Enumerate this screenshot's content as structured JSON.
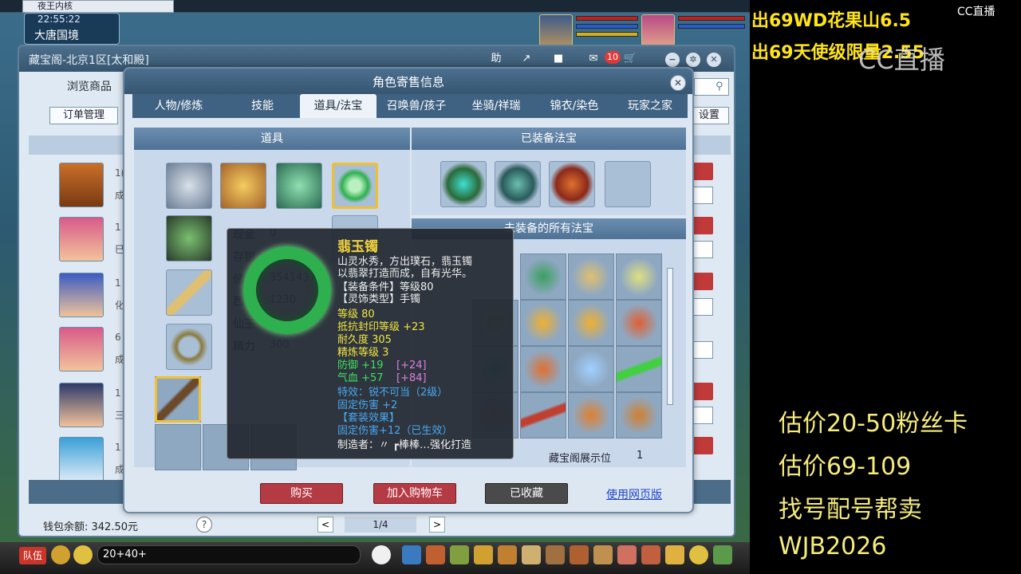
{
  "browser_tab": "夜王内核",
  "clock": "22:55:22",
  "location": "大唐国境",
  "main_window": {
    "title": "藏宝阁-北京1区[太和殿]",
    "help_btn": "助",
    "notification_count": "10",
    "browse_tab": "浏览商品",
    "order_btn": "订单管理",
    "settings_btn": "设置",
    "rows": [
      {
        "level": "1(",
        "sub": "成"
      },
      {
        "level": "1",
        "sub": "巳"
      },
      {
        "level": "1",
        "sub": "化"
      },
      {
        "level": "6",
        "sub": "成"
      },
      {
        "level": "1",
        "sub": "三"
      },
      {
        "level": "1",
        "sub": "成"
      }
    ],
    "wallet": "钱包余额: 342.50元",
    "help_icon": "?",
    "pager_prev": "<",
    "pager_text": "1/4",
    "pager_next": ">"
  },
  "dialog": {
    "title": "角色寄售信息",
    "close": "✕",
    "tabs": [
      "人物/修炼",
      "技能",
      "道具/法宝",
      "召唤兽/孩子",
      "坐骑/祥瑞",
      "锦衣/染色",
      "玩家之家"
    ],
    "left_header": "道具",
    "right_header": "已装备法宝",
    "right_sub_header": "未装备的所有法宝",
    "stats": [
      {
        "label": "现金",
        "value": "0"
      },
      {
        "label": "存银",
        "value": ""
      },
      {
        "label": "储",
        "value": "3541437"
      },
      {
        "label": "西",
        "value": "1230"
      },
      {
        "label": "仙玉",
        "value": ""
      },
      {
        "label": "精力",
        "value": "300"
      }
    ],
    "showcase_label": "藏宝阁展示位",
    "showcase_value": "1",
    "buttons": {
      "buy": "购买",
      "add_cart": "加入购物车",
      "favorited": "已收藏",
      "web": "使用网页版"
    }
  },
  "tooltip": {
    "name": "翡玉镯",
    "lines": [
      {
        "text": "山灵水秀，方出璞石，翡玉镯",
        "color": "white"
      },
      {
        "text": "以翡翠打造而成，自有光华。",
        "color": "white"
      },
      {
        "text": "【装备条件】等级80",
        "color": "white"
      },
      {
        "text": "【灵饰类型】手镯",
        "color": "white"
      },
      {
        "text": "等级 80",
        "color": "yellow"
      },
      {
        "text": "抵抗封印等级 +23",
        "color": "yellow"
      },
      {
        "text": "耐久度 305",
        "color": "yellow"
      },
      {
        "text": "精炼等级 3",
        "color": "yellow"
      },
      {
        "text": "防御 +19",
        "color": "green",
        "extra": "[+24]"
      },
      {
        "text": "气血 +57",
        "color": "green",
        "extra": "[+84]"
      },
      {
        "text": "特效：锐不可当（2级）",
        "color": "blue"
      },
      {
        "text": "固定伤害 +2",
        "color": "blue"
      },
      {
        "text": "【套装效果】",
        "color": "blue"
      },
      {
        "text": "固定伤害+12（已生效）",
        "color": "blue"
      },
      {
        "text": "制造者：〃 ┏棒棒…强化打造",
        "color": "white"
      }
    ]
  },
  "bottom_bar": {
    "team": "队伍",
    "chat": "20+40+"
  },
  "overlay": {
    "top_line1": "出69WD花果山6.5",
    "top_line2": "出69天使级限量2.55",
    "cc_small": "CC直播",
    "cc_big": "CC直播",
    "right_lines": [
      "估价20-50粉丝卡",
      "估价69-109",
      "找号配号帮卖",
      " WJB2026"
    ]
  },
  "colors": {
    "overlay_yellow": "#ffe41a",
    "tooltip_gold": "#f3d33a",
    "jade_green": "#2fb04f",
    "buy_red": "#b43a44"
  }
}
